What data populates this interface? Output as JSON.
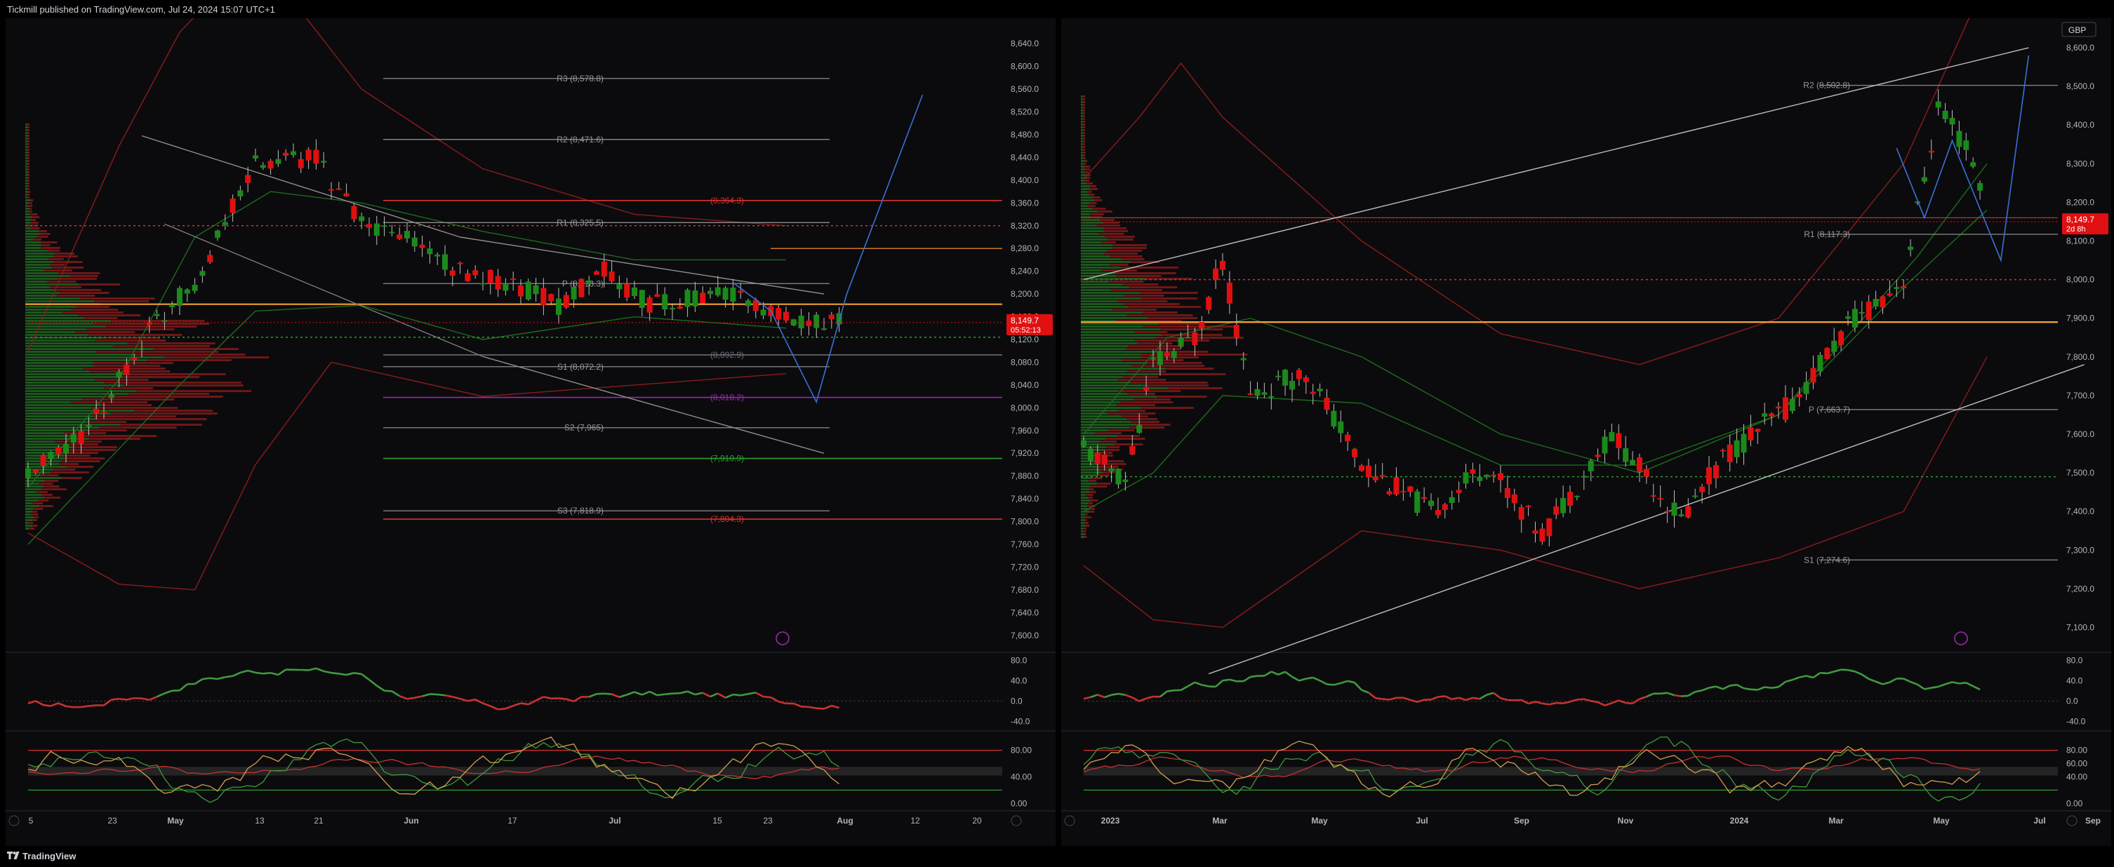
{
  "header": {
    "publisher": "Tickmill published on TradingView.com, Jul 24, 2024 15:07 UTC+1"
  },
  "footer": {
    "brand": "TradingView"
  },
  "colors": {
    "up": "#1a8a1a",
    "down": "#e01010",
    "pivot_line": "#8c8c8c",
    "orange": "#f0a030",
    "purple": "#9c27b0",
    "blue": "#3a6fd8",
    "red_level": "#d83030",
    "green_level": "#2e9e2e"
  },
  "chart_data": [
    {
      "type": "candlestick",
      "instrument_currency": "",
      "price_axis": {
        "ticks": [
          "8,640.0",
          "8,600.0",
          "8,560.0",
          "8,520.0",
          "8,480.0",
          "8,440.0",
          "8,400.0",
          "8,360.0",
          "8,320.0",
          "8,280.0",
          "8,240.0",
          "8,200.0",
          "8,160.0",
          "8,120.0",
          "8,080.0",
          "8,040.0",
          "8,000.0",
          "7,960.0",
          "7,920.0",
          "7,880.0",
          "7,840.0",
          "7,800.0",
          "7,760.0",
          "7,720.0",
          "7,680.0",
          "7,640.0",
          "7,600.0"
        ],
        "ylim": [
          7580,
          8660
        ]
      },
      "time_axis": {
        "ticks": [
          "5",
          "23",
          "May",
          "13",
          "21",
          "Jun",
          "17",
          "Jul",
          "15",
          "23",
          "Aug",
          "12",
          "20"
        ]
      },
      "last_price": {
        "value": "8,149.7",
        "countdown": "05:52:13"
      },
      "pivot_levels": [
        {
          "label": "R3 (8,578.8)",
          "value": 8578.8
        },
        {
          "label": "R2 (8,471.6)",
          "value": 8471.6
        },
        {
          "label": "R1 (8,325.5)",
          "value": 8325.5
        },
        {
          "label": "P (8,218.3)",
          "value": 8218.3
        },
        {
          "label": "S1 (8,072.2)",
          "value": 8072.2
        },
        {
          "label": "S2 (7,965)",
          "value": 7965
        },
        {
          "label": "S3 (7,818.9)",
          "value": 7818.9
        }
      ],
      "colored_levels": [
        {
          "label": "(8,364.3)",
          "value": 8364.3,
          "color": "red"
        },
        {
          "label": "(8,092.9)",
          "value": 8092.9,
          "color": "grey"
        },
        {
          "label": "(8,018.2)",
          "value": 8018.2,
          "color": "purple"
        },
        {
          "label": "(7,910.9)",
          "value": 7910.9,
          "color": "green"
        },
        {
          "label": "(7,804.3)",
          "value": 7804.3,
          "color": "red"
        }
      ],
      "rsi_panel": {
        "ticks": [
          "80.0",
          "40.0",
          "0.0",
          "-40.0"
        ],
        "ylim": [
          -50,
          90
        ]
      },
      "stoch_panel": {
        "ticks": [
          "80.00",
          "40.00",
          "0.00"
        ],
        "ylim": [
          -5,
          105
        ]
      }
    },
    {
      "type": "candlestick",
      "instrument_currency": "GBP",
      "price_axis": {
        "ticks": [
          "8,600.0",
          "8,500.0",
          "8,400.0",
          "8,300.0",
          "8,200.0",
          "8,100.0",
          "8,000.0",
          "7,900.0",
          "7,800.0",
          "7,700.0",
          "7,600.0",
          "7,500.0",
          "7,400.0",
          "7,300.0",
          "7,200.0",
          "7,100.0"
        ],
        "ylim": [
          7050,
          8640
        ]
      },
      "time_axis": {
        "ticks": [
          "2023",
          "Mar",
          "May",
          "Jul",
          "Sep",
          "Nov",
          "2024",
          "Mar",
          "May",
          "Jul",
          "Sep"
        ]
      },
      "last_price": {
        "value": "8,149.7",
        "countdown": "2d 8h"
      },
      "pivot_levels": [
        {
          "label": "R2 (8,502.8)",
          "value": 8502.8
        },
        {
          "label": "R1 (8,117.3)",
          "value": 8117.3
        },
        {
          "label": "P (7,663.7)",
          "value": 7663.7
        },
        {
          "label": "S1 (7,274.6)",
          "value": 7274.6
        }
      ],
      "rsi_panel": {
        "ticks": [
          "80.0",
          "40.0",
          "0.0",
          "-40.0"
        ],
        "ylim": [
          -50,
          90
        ]
      },
      "stoch_panel": {
        "ticks": [
          "80.00",
          "60.00",
          "40.00",
          "0.00"
        ],
        "ylim": [
          -5,
          105
        ]
      }
    }
  ]
}
